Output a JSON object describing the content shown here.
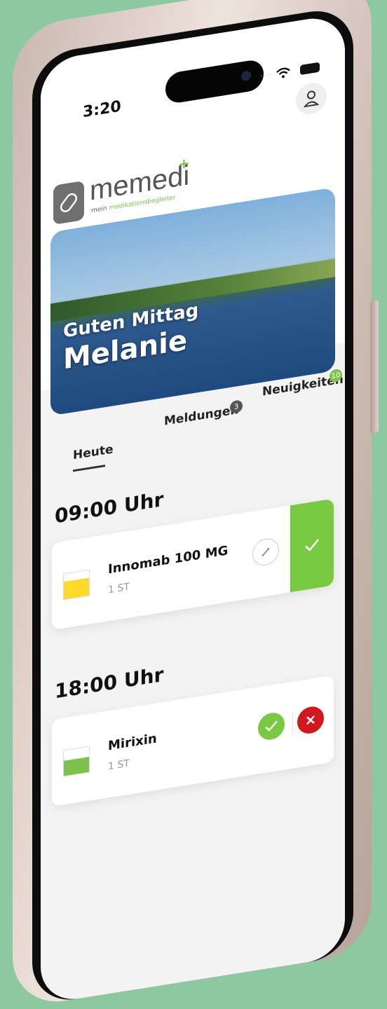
{
  "status": {
    "time": "3:20"
  },
  "brand": {
    "name": "memedi",
    "tagline_pre": "mein ",
    "tagline_accent": "medikationsbegleiter"
  },
  "hero": {
    "greeting": "Guten Mittag",
    "name": "Melanie"
  },
  "tabs": [
    {
      "label": "Heute",
      "badge": ""
    },
    {
      "label": "Meldungen",
      "badge": "3"
    },
    {
      "label": "Neuigkeiten",
      "badge": "10"
    }
  ],
  "schedule": [
    {
      "time": "09:00 Uhr",
      "medication": "Innomab 100 MG",
      "quantity": "1 ST"
    },
    {
      "time": "18:00 Uhr",
      "medication": "Mirixin",
      "quantity": "1 ST"
    }
  ],
  "colors": {
    "accent": "#7ac943",
    "danger": "#d0181f",
    "background": "#8dc8a0"
  },
  "icons": {
    "profile": "user-icon",
    "edit": "pencil-icon",
    "confirm": "check-icon",
    "reject": "close-icon"
  }
}
